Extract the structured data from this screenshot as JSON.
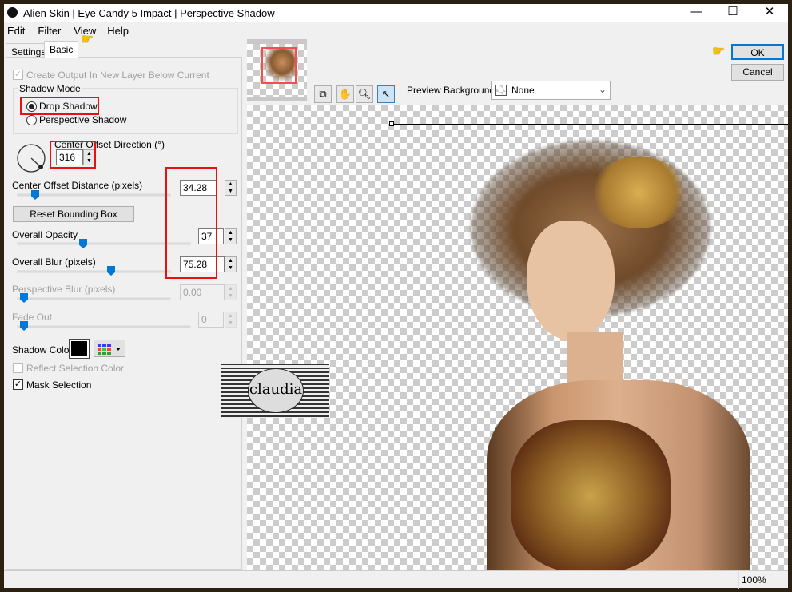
{
  "window": {
    "title": "Alien Skin | Eye Candy 5 Impact | Perspective Shadow",
    "minimize": "—",
    "maximize": "☐",
    "close": "✕"
  },
  "menu": [
    "Edit",
    "Filter",
    "View",
    "Help"
  ],
  "tabs": [
    "Settings",
    "Basic"
  ],
  "basic": {
    "create_output": "Create Output In New Layer Below Current",
    "shadow_mode_label": "Shadow Mode",
    "drop_shadow": "Drop Shadow",
    "perspective_shadow": "Perspective Shadow",
    "selected_mode": "Drop Shadow",
    "direction_label": "Center Offset Direction (°)",
    "direction_value": "316",
    "distance_label": "Center Offset Distance (pixels)",
    "distance_value": "34.28",
    "reset_button": "Reset Bounding Box",
    "opacity_label": "Overall Opacity",
    "opacity_value": "37",
    "blur_label": "Overall Blur (pixels)",
    "blur_value": "75.28",
    "persp_blur_label": "Perspective Blur (pixels)",
    "persp_blur_value": "0.00",
    "fade_label": "Fade Out",
    "fade_value": "0",
    "shadow_color_label": "Shadow Color",
    "shadow_color": "#000000",
    "reflect_label": "Reflect Selection Color",
    "mask_label": "Mask Selection",
    "mask_checked": true
  },
  "preview": {
    "bg_label": "Preview Background:",
    "bg_value": "None",
    "ok": "OK",
    "cancel": "Cancel",
    "zoom": "100%"
  },
  "watermark": "claudia"
}
